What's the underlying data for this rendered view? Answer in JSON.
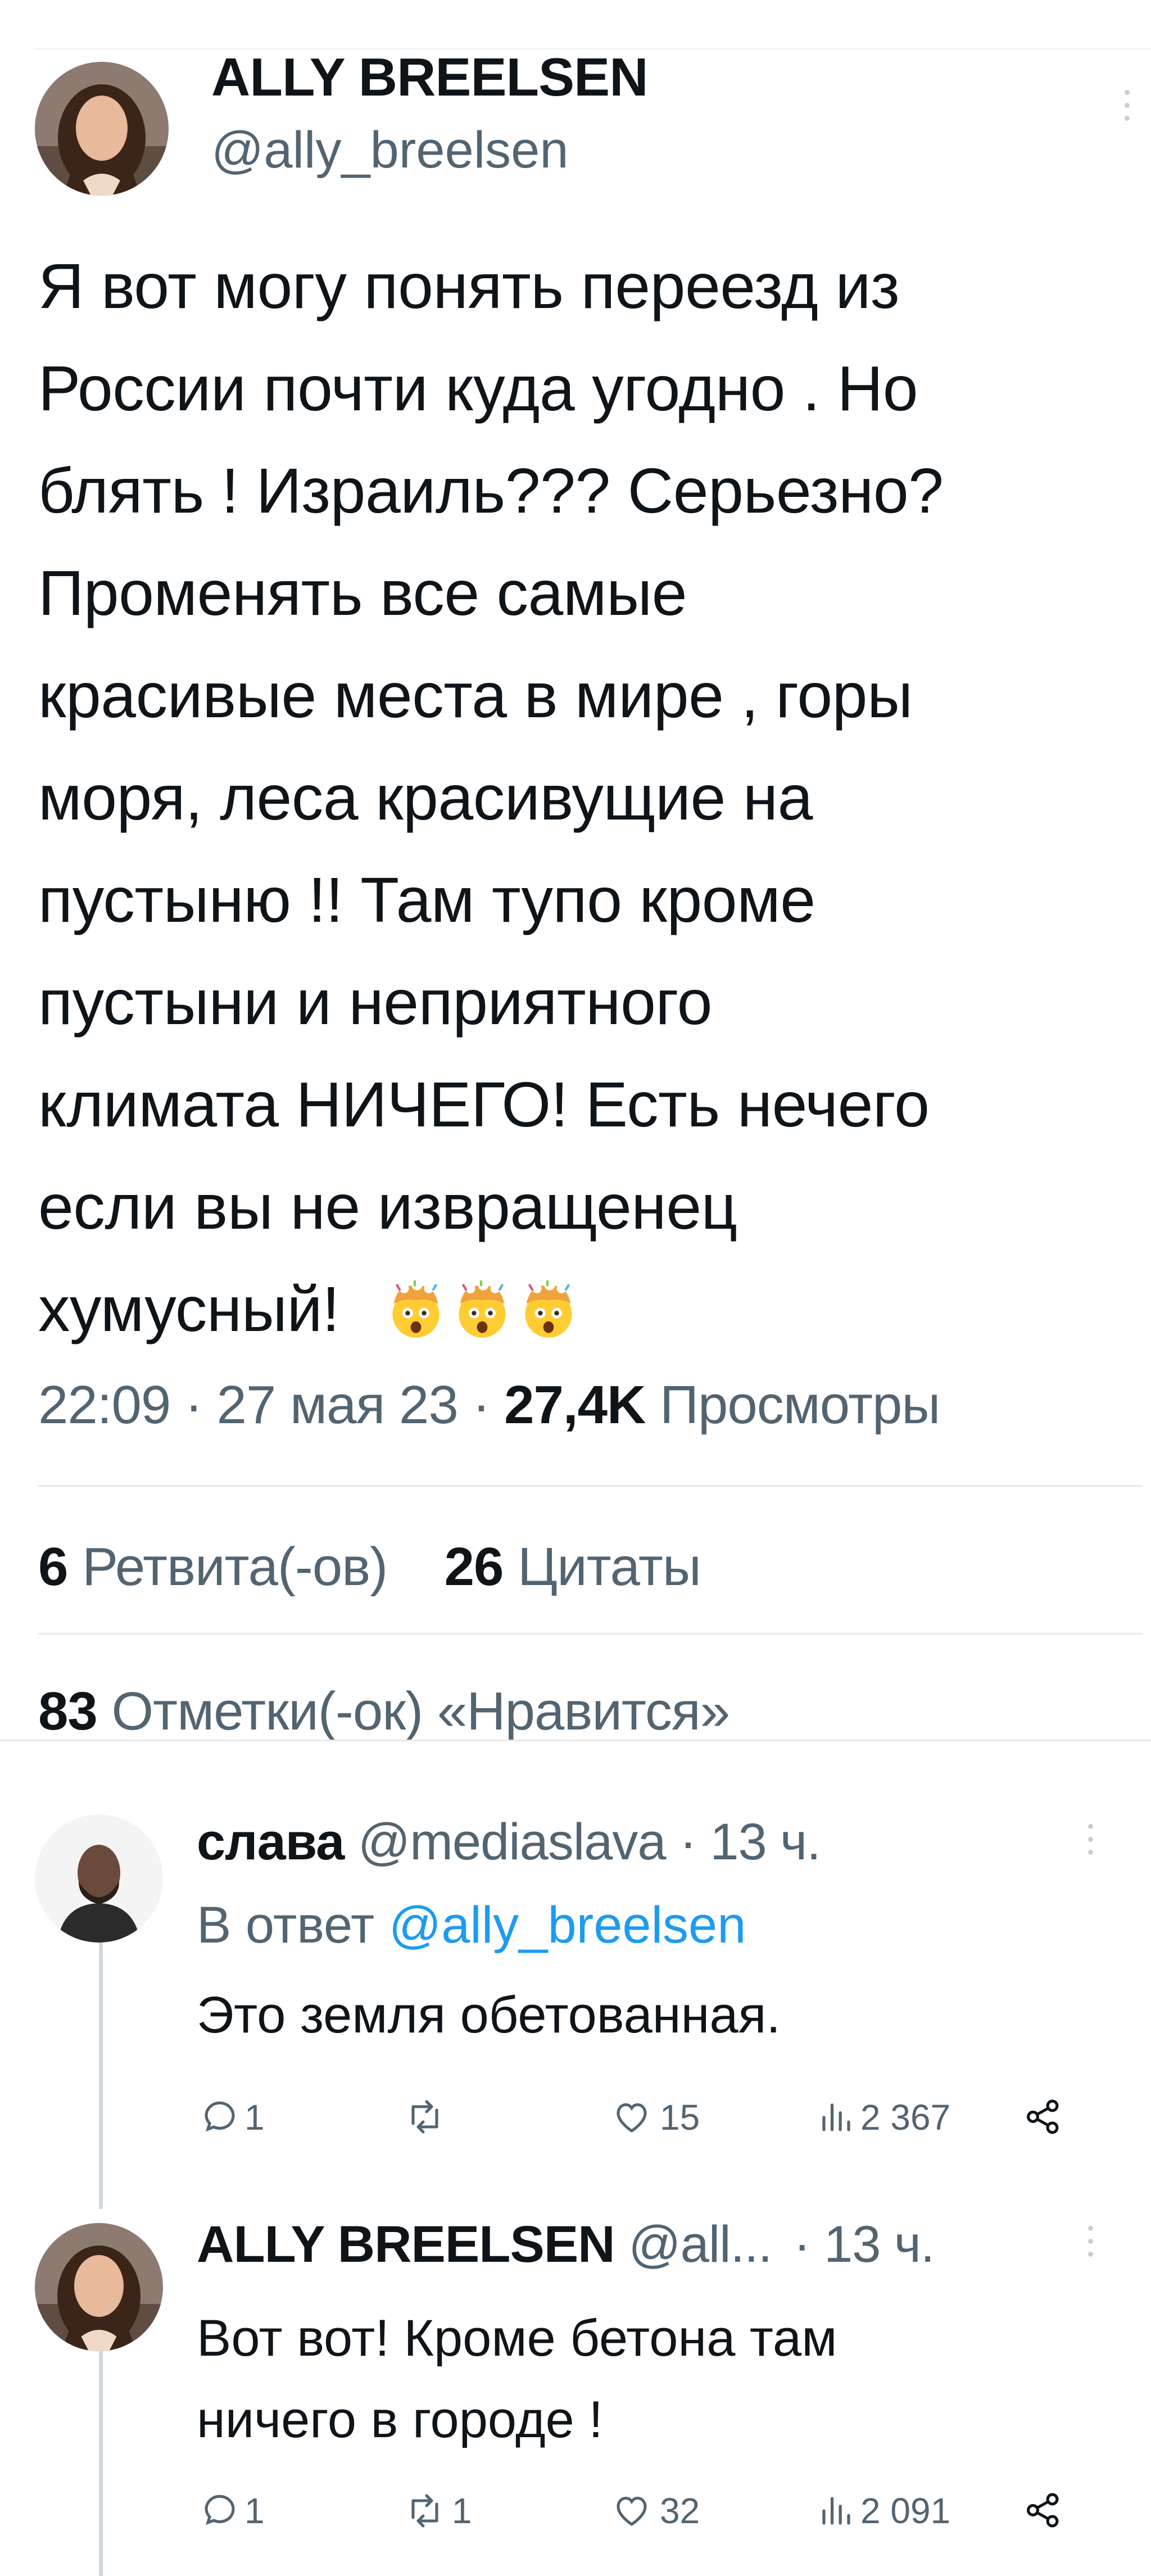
{
  "main_tweet": {
    "display_name": "ALLY BREELSEN",
    "handle": "@ally_breelsen",
    "text_lines": [
      "Я вот могу понять переезд из",
      "России почти куда угодно . Но",
      "блять ! Израиль??? Серьезно?",
      "Променять все самые",
      "красивые места в мире , горы",
      "моря, леса красивущие на",
      "пустыню !! Там тупо кроме",
      "пустыни и неприятного",
      "климата НИЧЕГО! Есть нечего",
      "если вы не извращенец",
      "хумусный!"
    ],
    "emoji": [
      "exploding-head",
      "exploding-head",
      "exploding-head"
    ],
    "time": "22:09",
    "date": "27 мая 23",
    "views_count": "27,4K",
    "views_label": "Просмотры",
    "separator": "·",
    "retweets_count": "6",
    "retweets_label": "Ретвита(-ов)",
    "quotes_count": "26",
    "quotes_label": "Цитаты",
    "likes_count": "83",
    "likes_label": "Отметки(-ок) «Нравится»"
  },
  "replies": [
    {
      "display_name": "слава",
      "handle": "@mediaslava",
      "time": "· 13 ч.",
      "reply_to_label": "В ответ",
      "reply_to_handle": "@ally_breelsen",
      "text_lines": [
        "Это земля обетованная."
      ],
      "stats": {
        "replies": "1",
        "retweets": "",
        "likes": "15",
        "views": "2 367"
      }
    },
    {
      "display_name": "ALLY BREELSEN",
      "handle": "@all...",
      "time": "· 13 ч.",
      "text_lines": [
        "Вот вот! Кроме бетона там",
        "ничего в городе !"
      ],
      "stats": {
        "replies": "1",
        "retweets": "1",
        "likes": "32",
        "views": "2 091"
      }
    }
  ],
  "colors": {
    "text": "#0f1419",
    "muted": "#536471",
    "link": "#1d9bf0",
    "separator": "#e7e9ea",
    "thread_line": "#cfd9de"
  },
  "icons": [
    "more-icon",
    "reply-icon",
    "retweet-icon",
    "like-icon",
    "views-icon",
    "share-icon"
  ]
}
